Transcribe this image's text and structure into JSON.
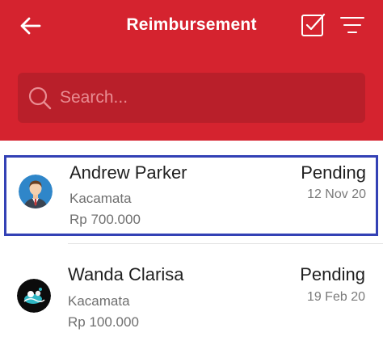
{
  "header": {
    "title": "Reimbursement",
    "background_color": "#d5232f",
    "back_icon": "arrow-left-icon",
    "check_icon": "checkbox-icon",
    "filter_icon": "filter-lines-icon"
  },
  "search": {
    "placeholder": "Search...",
    "value": ""
  },
  "items": [
    {
      "name": "Andrew Parker",
      "category": "Kacamata",
      "amount": "Rp 700.000",
      "status": "Pending",
      "date": "12 Nov 20",
      "selected": true,
      "avatar": "avatar-man-suit"
    },
    {
      "name": "Wanda Clarisa",
      "category": "Kacamata",
      "amount": "Rp 100.000",
      "status": "Pending",
      "date": "19 Feb 20",
      "selected": false,
      "avatar": "avatar-dark-illustration"
    }
  ],
  "colors": {
    "accent": "#d5232f",
    "selection_border": "#3341b5"
  }
}
